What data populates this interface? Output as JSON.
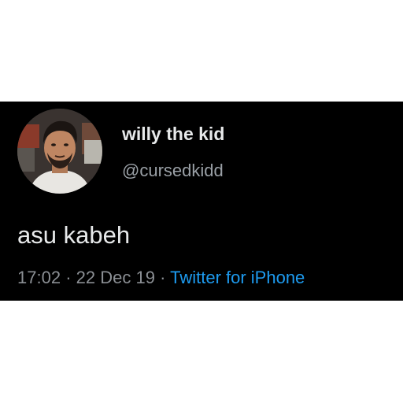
{
  "tweet": {
    "author": {
      "display_name": "willy the kid",
      "handle": "@cursedkidd",
      "avatar_icon": "profile-photo"
    },
    "text": "asu kabeh",
    "time": "17:02",
    "separator": "·",
    "date": "22 Dec 19",
    "source": "Twitter for iPhone"
  },
  "colors": {
    "card_background": "#000000",
    "page_background": "#ffffff",
    "primary_text": "#e7e9ea",
    "secondary_text": "#8b8f94",
    "link": "#1d9bf0"
  }
}
